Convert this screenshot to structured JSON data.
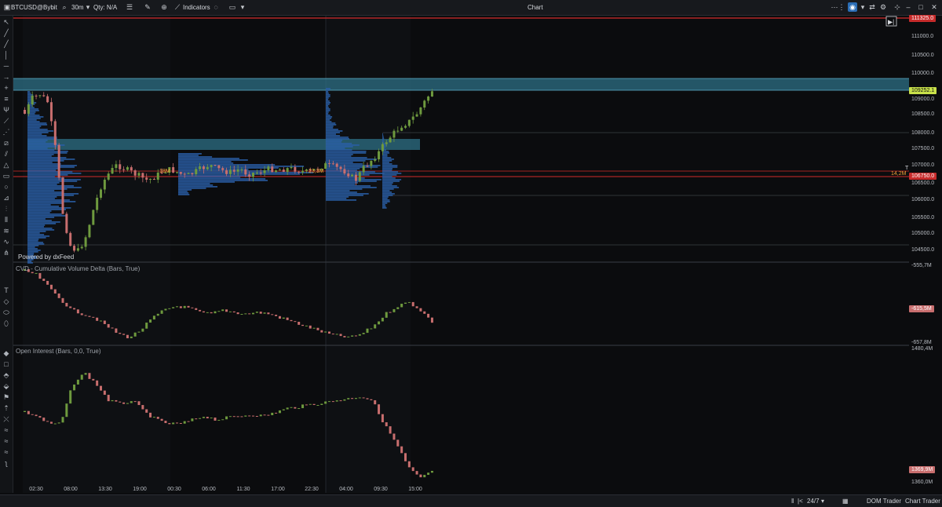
{
  "topbar": {
    "symbol": "BTCUSD@Bybit",
    "timeframe": "30m",
    "qty": "Qty: N/A",
    "indicators": "Indicators",
    "title": "Chart"
  },
  "chart": {
    "powered_by": "Powered by  dxFeed",
    "price_axis": [
      "111000.0",
      "110500.0",
      "110000.0",
      "109000.0",
      "108500.0",
      "108000.0",
      "107500.0",
      "107000.0",
      "106500.0",
      "106000.0",
      "105500.0",
      "105000.0",
      "104500.0"
    ],
    "price_tags": {
      "top_red": "111325.0",
      "current": "109252.1",
      "red_level": "106750.0",
      "volume_marker": "14,2M"
    },
    "profile_labels": {
      "left": "18M",
      "right": "23,3M"
    }
  },
  "cvd": {
    "title": "CVD - Cumulative Volume Delta (Bars, True)",
    "axis_top": "-555,7M",
    "axis_bottom": "-657,8M",
    "tag": "-615,5M"
  },
  "oi": {
    "title": "Open Interest (Bars, 0,0, True)",
    "axis_top": "1480,4M",
    "axis_bottom": "1360,0M",
    "tag": "1369,9M"
  },
  "time_axis": [
    "02:30",
    "08:00",
    "13:30",
    "19:00",
    "00:30",
    "06:00",
    "11:30",
    "17:00",
    "22:30",
    "04:00",
    "09:30",
    "15:00"
  ],
  "status": {
    "session": "24/7",
    "dom_trader": "DOM Trader",
    "chart_trader": "Chart Trader"
  },
  "colors": {
    "up": "#6e9a3e",
    "down": "#c86e6e",
    "zone": "#2d6f86",
    "red_level": "#d22b2b",
    "current_tag": "#c8e04a"
  }
}
